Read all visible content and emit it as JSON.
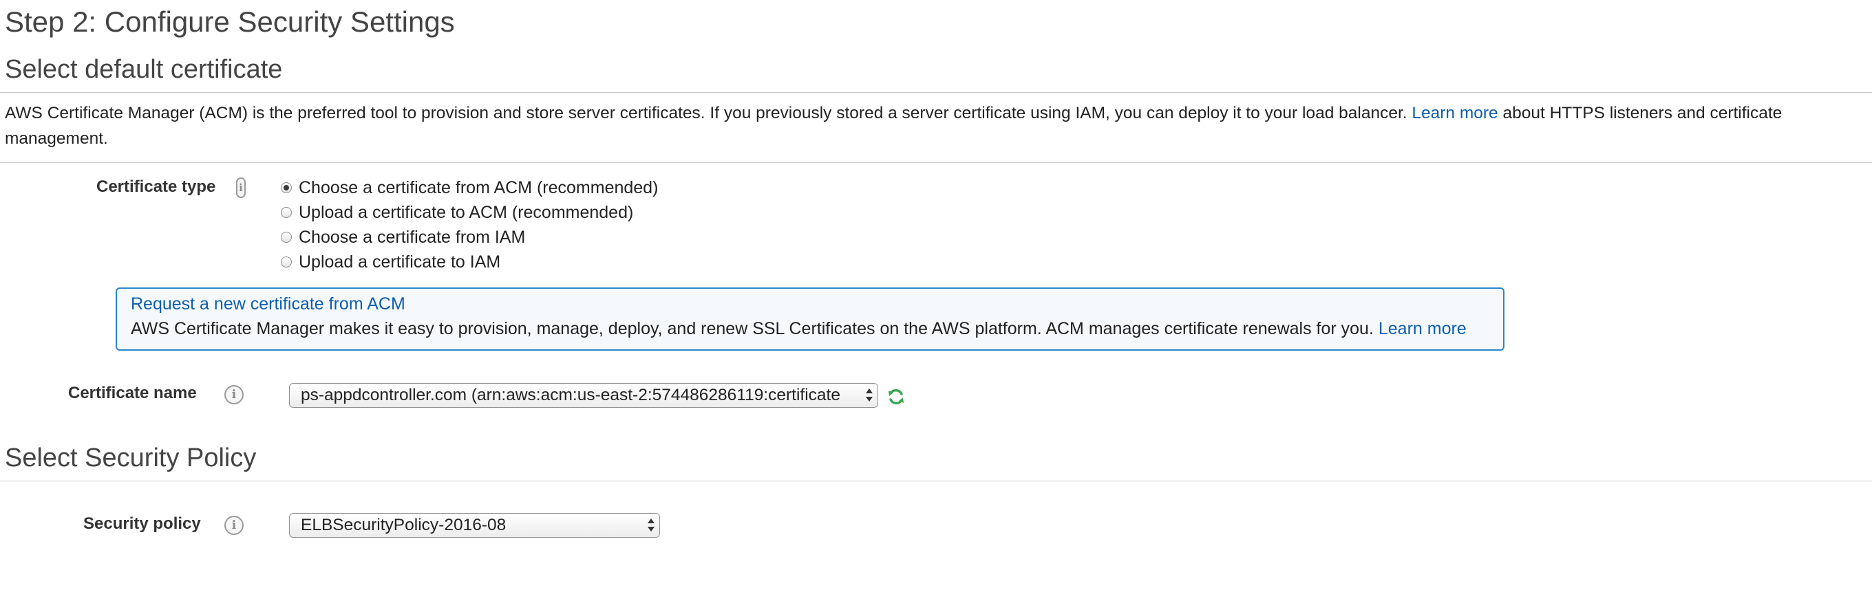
{
  "page": {
    "step_title": "Step 2: Configure Security Settings"
  },
  "default_certificate": {
    "heading": "Select default certificate",
    "description_before_link": "AWS Certificate Manager (ACM) is the preferred tool to provision and store server certificates. If you previously stored a server certificate using IAM, you can deploy it to your load balancer. ",
    "learn_more_label": "Learn more",
    "description_after_link": " about HTTPS listeners and certificate management."
  },
  "certificate_type": {
    "label": "Certificate type",
    "info_icon": "info-icon",
    "options": [
      {
        "label": "Choose a certificate from ACM (recommended)",
        "checked": true
      },
      {
        "label": "Upload a certificate to ACM (recommended)",
        "checked": false
      },
      {
        "label": "Choose a certificate from IAM",
        "checked": false
      },
      {
        "label": "Upload a certificate to IAM",
        "checked": false
      }
    ]
  },
  "acm_request": {
    "link_label": "Request a new certificate from ACM",
    "text": "AWS Certificate Manager makes it easy to provision, manage, deploy, and renew SSL Certificates on the AWS platform. ACM manages certificate renewals for you. ",
    "learn_more_label": "Learn more"
  },
  "certificate_name": {
    "label": "Certificate name",
    "info_icon": "info-icon",
    "selected_value": "ps-appdcontroller.com (arn:aws:acm:us-east-2:574486286119:certificate",
    "refresh_icon": "refresh-icon"
  },
  "security_policy_section": {
    "heading": "Select Security Policy",
    "label": "Security policy",
    "info_icon": "info-icon",
    "selected_value": "ELBSecurityPolicy-2016-08"
  },
  "colors": {
    "link": "#0d5fae",
    "box_border": "#2a86c9",
    "heading_text": "#444444",
    "refresh_icon": "#3aa655"
  }
}
